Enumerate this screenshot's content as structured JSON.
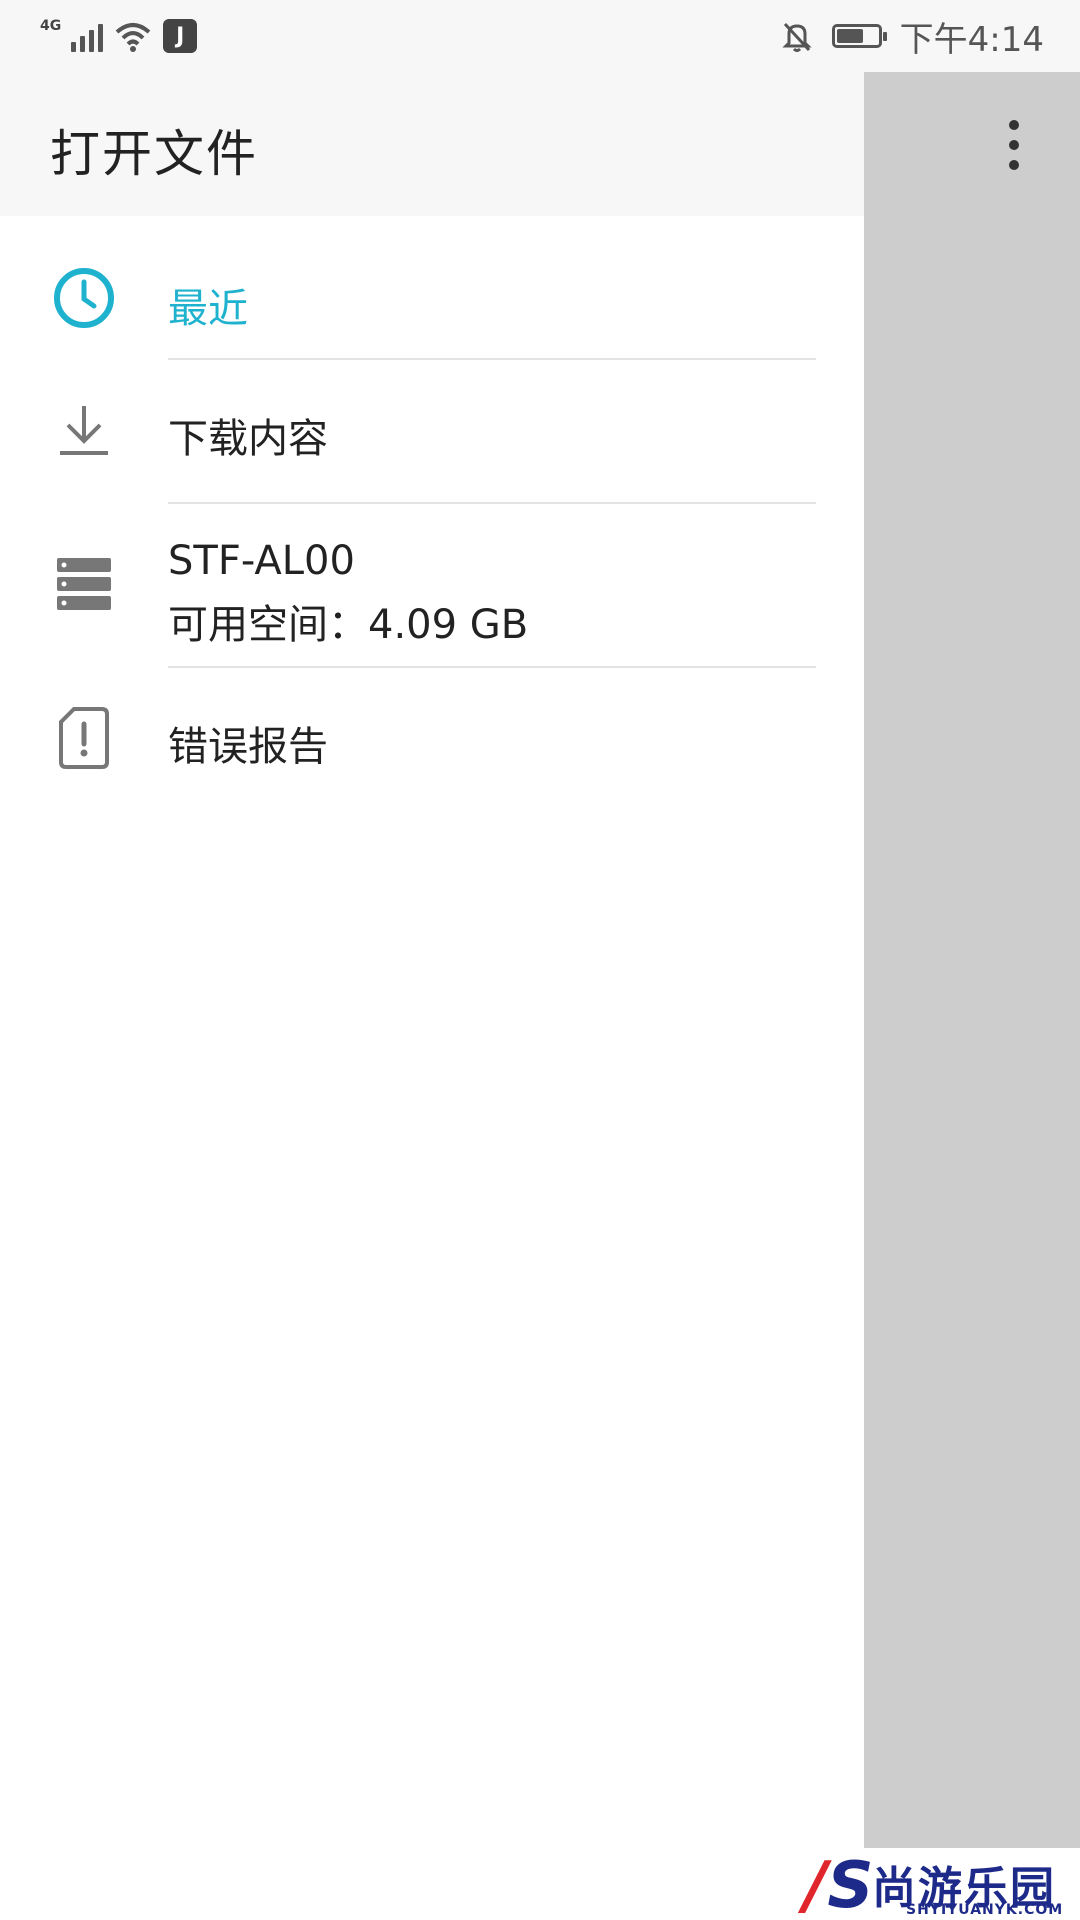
{
  "status_bar": {
    "network": "4G",
    "app_badge": "J",
    "time": "下午4:14",
    "icons": [
      "signal-icon",
      "wifi-icon",
      "app-badge-icon",
      "mute-notification-icon",
      "battery-icon"
    ]
  },
  "app_bar": {
    "title": "打开文件",
    "overflow_icon": "more-vert-icon"
  },
  "drawer": {
    "items": [
      {
        "label": "最近",
        "icon": "clock-icon",
        "active": true
      },
      {
        "label": "下载内容",
        "icon": "download-icon"
      },
      {
        "label": "STF-AL00",
        "sublabel": "可用空间：4.09 GB",
        "icon": "storage-icon"
      },
      {
        "label": "错误报告",
        "icon": "bug-report-icon"
      }
    ]
  },
  "watermark": {
    "logo_letter": "S",
    "title": "尚游乐园",
    "subtitle": "SHYIYUANYK.COM"
  },
  "colors": {
    "accent": "#1fb2cf",
    "scrim": "#cdcdcd",
    "app_bar_bg": "#f7f7f7",
    "watermark_blue": "#1d2a8a",
    "watermark_red": "#e0252b"
  }
}
